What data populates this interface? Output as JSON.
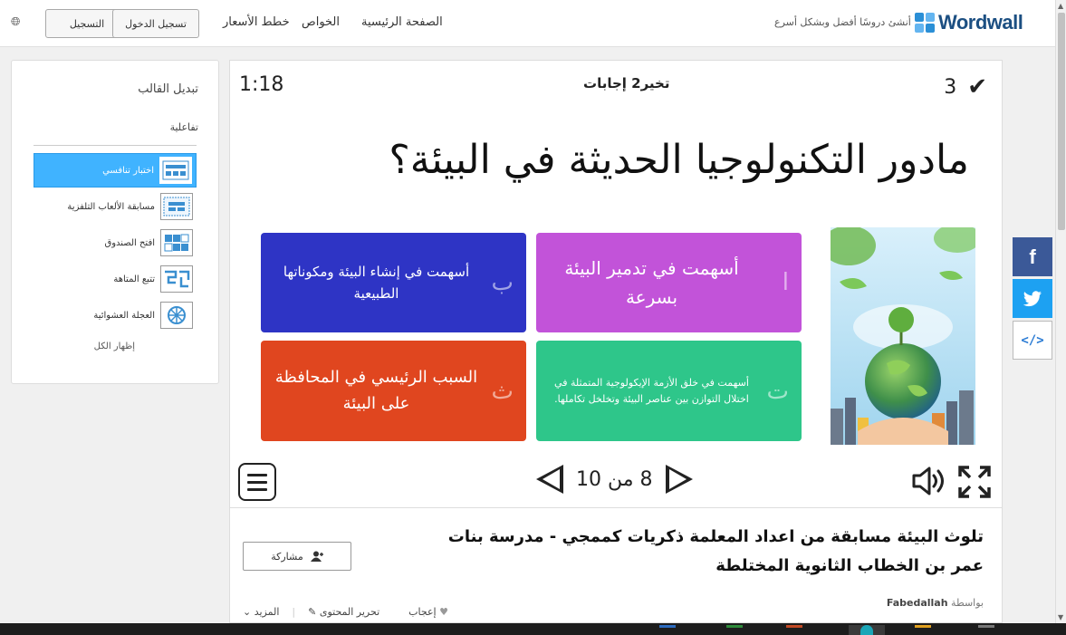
{
  "topbar": {
    "logo_text": "Wordwall",
    "tagline": "أنشئ دروسًا أفضل وبشكل أسرع",
    "nav_home": "الصفحة الرئيسية",
    "nav_features": "الخواص",
    "nav_pricing": "خطط الأسعار",
    "login_label": "تسجيل الدخول",
    "signup_label": "التسجيل",
    "globe_icon": "globe-icon"
  },
  "template_panel": {
    "title": "تبديل القالب",
    "subtitle": "تفاعلية",
    "items": [
      {
        "label": "اختبار تنافسي",
        "icon": "quiz-template-thumb",
        "active": true
      },
      {
        "label": "مسابقة الألعاب التلفزية",
        "icon": "gameshow-template-thumb"
      },
      {
        "label": "افتح الصندوق",
        "icon": "open-box-template-thumb"
      },
      {
        "label": "تتبع المتاهة",
        "icon": "maze-template-thumb"
      },
      {
        "label": "العجلة العشوائية",
        "icon": "wheel-template-thumb"
      }
    ],
    "show_all": "إظهار الكل"
  },
  "game": {
    "timer": "1:18",
    "skip_label": "تخير2 إجابات",
    "score": "3",
    "question": "مادور التكنولوجيا الحديثة في البيئة؟",
    "answers": [
      {
        "letter": "ا",
        "text": "أسهمت في تدمير البيئة بسرعة",
        "color": "#c253d9"
      },
      {
        "letter": "ب",
        "text": "أسهمت في إنشاء البيئة ومكوناتها الطبيعية",
        "color": "#2e34c5"
      },
      {
        "letter": "ت",
        "text": "أسهمت في خلق الأزمة الإيكولوجية المتمثلة في اختلال التوازن بين عناصر البيئة وتخلخل تكاملها.",
        "color": "#2ec68a"
      },
      {
        "letter": "ث",
        "text": "السبب الرئيسي في المحافظة على البيئة",
        "color": "#e0461f"
      }
    ],
    "pager": "8 من 10"
  },
  "description": {
    "title": "تلوث البيئة مسابقة من اعداد المعلمة ذكريات كممجي - مدرسة بنات عمر بن الخطاب الثانوية المختلطة",
    "share_label": "مشاركة",
    "by_label": "بواسطة",
    "author": "Fabedallah",
    "like_label": "إعجاب",
    "edit_label": "تحرير المحتوى",
    "more_label": "المزيد"
  },
  "social": {
    "facebook": "f",
    "embed": "</>"
  },
  "colors": {
    "active_template": "#40b3ff",
    "facebook": "#3b5998",
    "twitter": "#1da1f2",
    "logo": "#1c4f82"
  }
}
